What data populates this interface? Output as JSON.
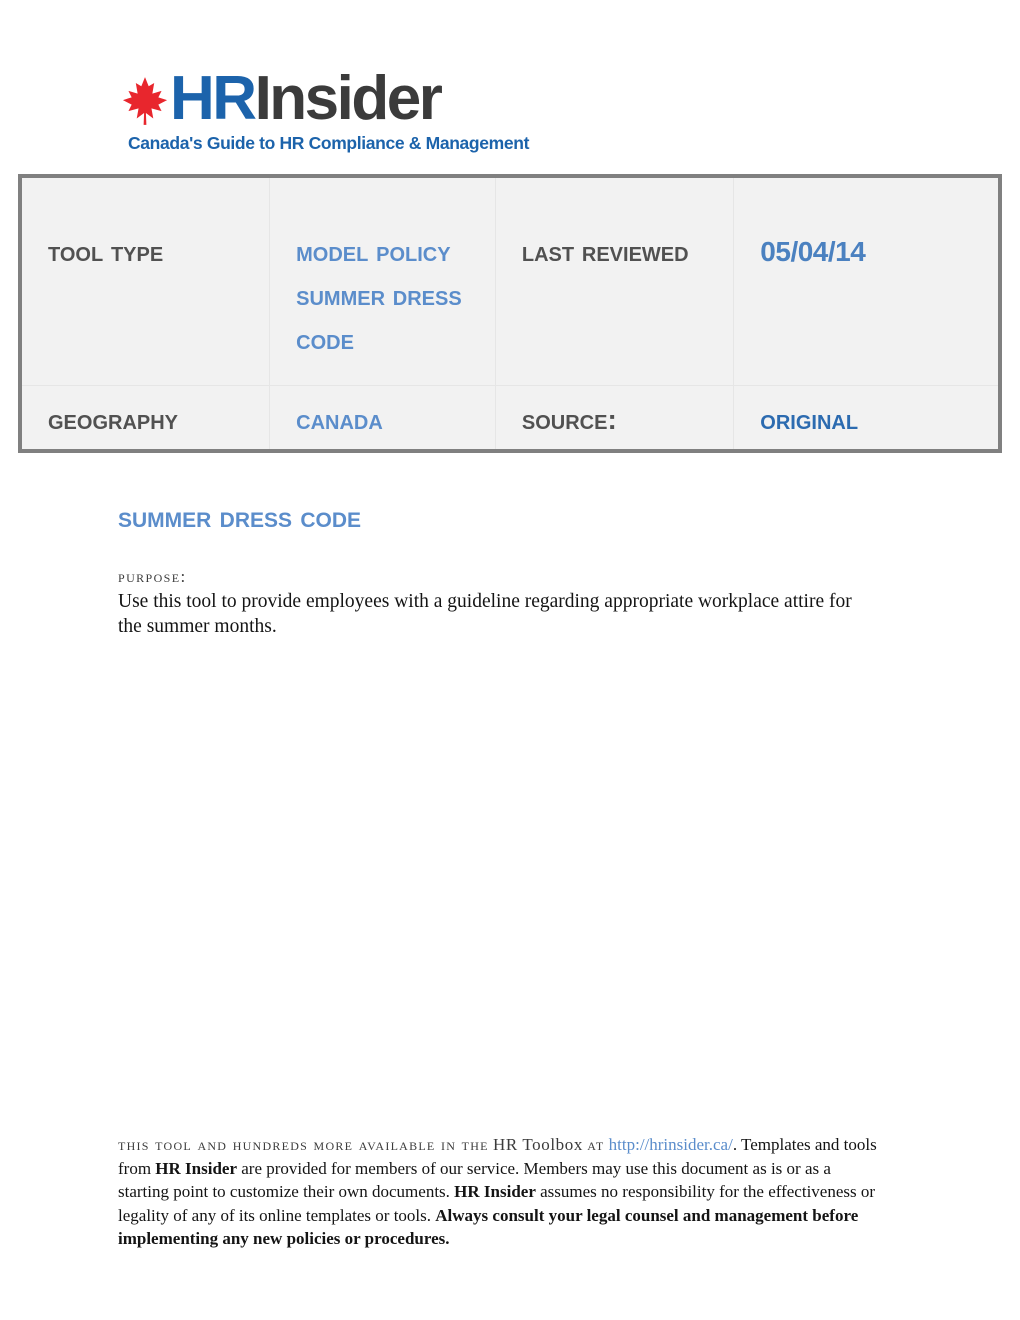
{
  "logo": {
    "leaf_icon": "maple-leaf-icon",
    "word_primary": "HR",
    "word_secondary": "Insider",
    "tagline": "Canada's Guide to HR Compliance & Management",
    "colors": {
      "blue": "#1c63ab",
      "dark": "#3b3b3b",
      "red": "#e8262d"
    }
  },
  "meta_table": {
    "border_color": "#808080",
    "background": "#f2f2f2",
    "rows": [
      {
        "label_left": "Tool Type",
        "value_left": "Model Policy Summer Dress Code",
        "label_right": "Last Reviewed",
        "value_right": "05/04/14"
      },
      {
        "label_left": "Geography",
        "value_left": "Canada",
        "label_right": "Source:",
        "value_right": "Original"
      }
    ],
    "label_color": "#515151",
    "value_color": "#5b8dcb",
    "date_color": "#4b81c0",
    "source_value_color": "#2c6bb0"
  },
  "document": {
    "heading": "Summer Dress Code",
    "heading_color": "#5b8dcb",
    "purpose_label": "Purpose:",
    "purpose_text": "Use this tool to provide employees with a guideline regarding appropriate workplace attire for the summer months."
  },
  "footer": {
    "lead_caps": "This tool and hundreds more available in the",
    "toolbox_caps": "HR Toolbox",
    "at_caps": "at",
    "url": "http://hrinsider.ca/",
    "after_url": ". Templates and tools from",
    "brand_1": "HR Insider",
    "segment_1": "are provided for members of our service. Members may use this document as is or as a starting point to customize their own documents.",
    "brand_2": "HR Insider",
    "segment_2": "assumes no responsibility for the effectiveness or legality of any of its online templates or tools.",
    "bold_warning": "Always consult your legal counsel and management before implementing any new policies or procedures.",
    "link_color": "#5b8dcb"
  }
}
